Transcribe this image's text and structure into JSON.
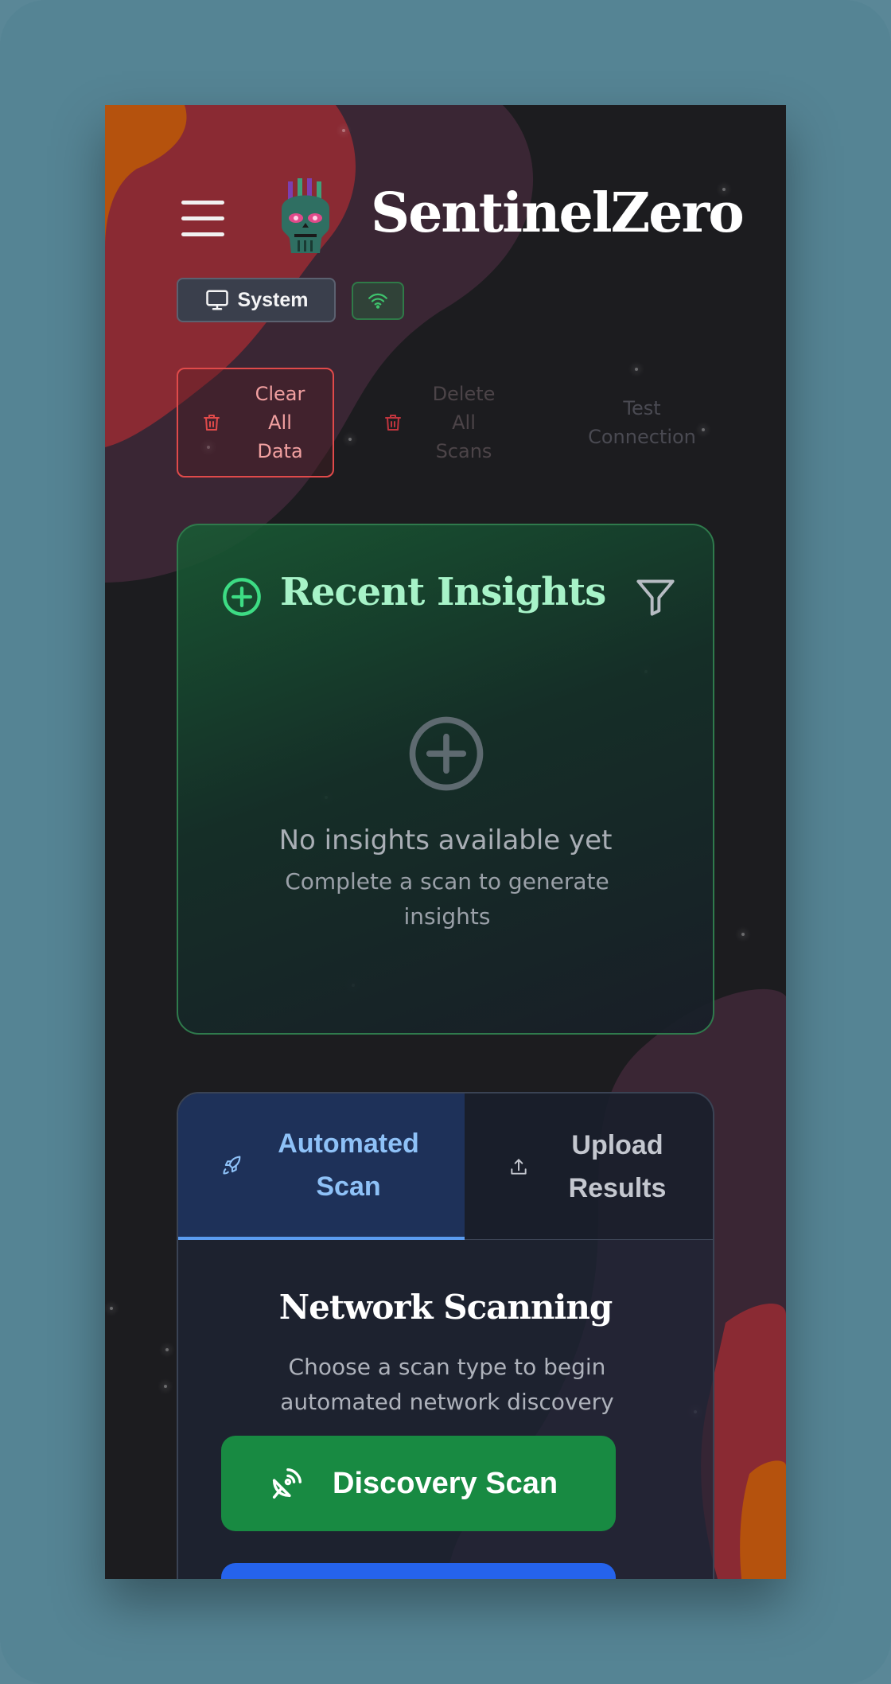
{
  "header": {
    "app_title": "SentinelZero",
    "menu_icon": "hamburger-menu-icon",
    "logo": "skull-logo"
  },
  "status": {
    "system_label": "System",
    "system_icon": "monitor-icon",
    "connection_icon": "wifi-icon",
    "connection_color": "#3ec46d"
  },
  "actions": {
    "clear_all_data": "Clear\nAll\nData",
    "delete_all_scans": "Delete\nAll\nScans",
    "test_connection": "Test\nConnection"
  },
  "insights": {
    "title": "Recent Insights",
    "empty_title": "No insights available yet",
    "empty_subtitle": "Complete a scan to generate insights",
    "accent_color": "#3ddc84"
  },
  "scan": {
    "tabs": [
      {
        "label": "Automated\nScan",
        "icon": "rocket-icon",
        "active": true
      },
      {
        "label": "Upload\nResults",
        "icon": "upload-icon",
        "active": false
      }
    ],
    "title": "Network Scanning",
    "subtitle": "Choose a scan type to begin automated network discovery",
    "discovery_button": "Discovery Scan",
    "discovery_icon": "satellite-dish-icon",
    "primary_green": "#188a42",
    "primary_blue": "#2563eb"
  }
}
